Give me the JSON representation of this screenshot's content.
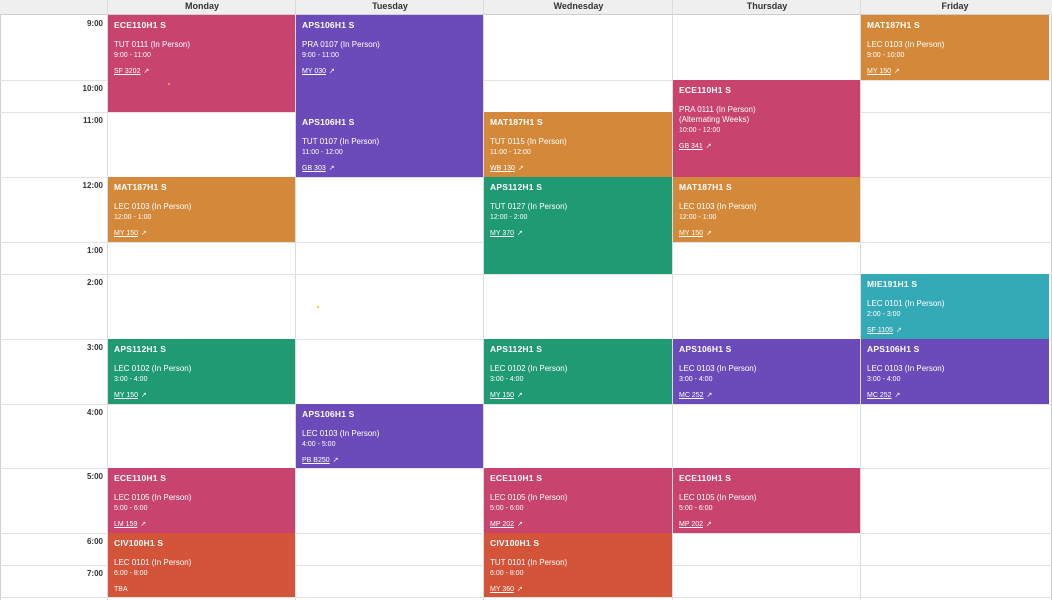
{
  "days": [
    "Monday",
    "Tuesday",
    "Wednesday",
    "Thursday",
    "Friday"
  ],
  "time_labels": [
    "9:00",
    "10:00",
    "11:00",
    "12:00",
    "1:00",
    "2:00",
    "3:00",
    "4:00",
    "5:00",
    "6:00",
    "7:00"
  ],
  "events": [
    {
      "id": "mon-ece110-tut",
      "course": "ECE110H1 S",
      "section": "TUT 0111 (In Person)",
      "note": "",
      "time": "9:00 - 11:00",
      "room": "SF 3202",
      "color": "#c9436f"
    },
    {
      "id": "tue-aps106-pra",
      "course": "APS106H1 S",
      "section": "PRA 0107 (In Person)",
      "note": "",
      "time": "9:00 - 11:00",
      "room": "MY 030",
      "color": "#6b4bba"
    },
    {
      "id": "fri-mat187-lec",
      "course": "MAT187H1 S",
      "section": "LEC 0103 (In Person)",
      "note": "",
      "time": "9:00 - 10:00",
      "room": "MY 150",
      "color": "#d4893a"
    },
    {
      "id": "thu-ece110-pra",
      "course": "ECE110H1 S",
      "section": "PRA 0111 (In Person)",
      "note": "(Alternating Weeks)",
      "time": "10:00 - 12:00",
      "room": "GB 341",
      "color": "#c9436f"
    },
    {
      "id": "tue-aps106-tut",
      "course": "APS106H1 S",
      "section": "TUT 0107 (In Person)",
      "note": "",
      "time": "11:00 - 12:00",
      "room": "GB 303",
      "color": "#6b4bba"
    },
    {
      "id": "wed-mat187-tut",
      "course": "MAT187H1 S",
      "section": "TUT 0115 (In Person)",
      "note": "",
      "time": "11:00 - 12:00",
      "room": "WB 130",
      "color": "#d4893a"
    },
    {
      "id": "mon-mat187-lec",
      "course": "MAT187H1 S",
      "section": "LEC 0103 (In Person)",
      "note": "",
      "time": "12:00 - 1:00",
      "room": "MY 150",
      "color": "#d4893a"
    },
    {
      "id": "wed-aps112-tut",
      "course": "APS112H1 S",
      "section": "TUT 0127 (In Person)",
      "note": "",
      "time": "12:00 - 2:00",
      "room": "MY 370",
      "color": "#1f9a73"
    },
    {
      "id": "thu-mat187-lec",
      "course": "MAT187H1 S",
      "section": "LEC 0103 (In Person)",
      "note": "",
      "time": "12:00 - 1:00",
      "room": "MY 150",
      "color": "#d4893a"
    },
    {
      "id": "fri-mie191-lec",
      "course": "MIE191H1 S",
      "section": "LEC 0101 (In Person)",
      "note": "",
      "time": "2:00 - 3:00",
      "room": "SF 1105",
      "color": "#35aab7"
    },
    {
      "id": "mon-aps112-lec",
      "course": "APS112H1 S",
      "section": "LEC 0102 (In Person)",
      "note": "",
      "time": "3:00 - 4:00",
      "room": "MY 150",
      "color": "#1f9a73"
    },
    {
      "id": "wed-aps112-lec",
      "course": "APS112H1 S",
      "section": "LEC 0102 (In Person)",
      "note": "",
      "time": "3:00 - 4:00",
      "room": "MY 150",
      "color": "#1f9a73"
    },
    {
      "id": "thu-aps106-lec",
      "course": "APS106H1 S",
      "section": "LEC 0103 (In Person)",
      "note": "",
      "time": "3:00 - 4:00",
      "room": "MC 252",
      "color": "#6b4bba"
    },
    {
      "id": "fri-aps106-lec",
      "course": "APS106H1 S",
      "section": "LEC 0103 (In Person)",
      "note": "",
      "time": "3:00 - 4:00",
      "room": "MC 252",
      "color": "#6b4bba"
    },
    {
      "id": "tue-aps106-lec",
      "course": "APS106H1 S",
      "section": "LEC 0103 (In Person)",
      "note": "",
      "time": "4:00 - 5:00",
      "room": "PB B250",
      "color": "#6b4bba"
    },
    {
      "id": "mon-ece110-lec",
      "course": "ECE110H1 S",
      "section": "LEC 0105 (In Person)",
      "note": "",
      "time": "5:00 - 6:00",
      "room": "LM 159",
      "color": "#c9436f"
    },
    {
      "id": "wed-ece110-lec",
      "course": "ECE110H1 S",
      "section": "LEC 0105 (In Person)",
      "note": "",
      "time": "5:00 - 6:00",
      "room": "MP 202",
      "color": "#c9436f"
    },
    {
      "id": "thu-ece110-lec",
      "course": "ECE110H1 S",
      "section": "LEC 0105 (In Person)",
      "note": "",
      "time": "5:00 - 6:00",
      "room": "MP 202",
      "color": "#c9436f"
    },
    {
      "id": "mon-civ100-lec",
      "course": "CIV100H1 S",
      "section": "LEC 0101 (In Person)",
      "note": "",
      "time": "6:00 - 8:00",
      "room": "TBA",
      "color": "#d4543a"
    },
    {
      "id": "wed-civ100-tut",
      "course": "CIV100H1 S",
      "section": "TUT 0101 (In Person)",
      "note": "",
      "time": "6:00 - 8:00",
      "room": "MY 360",
      "color": "#d4543a"
    }
  ]
}
